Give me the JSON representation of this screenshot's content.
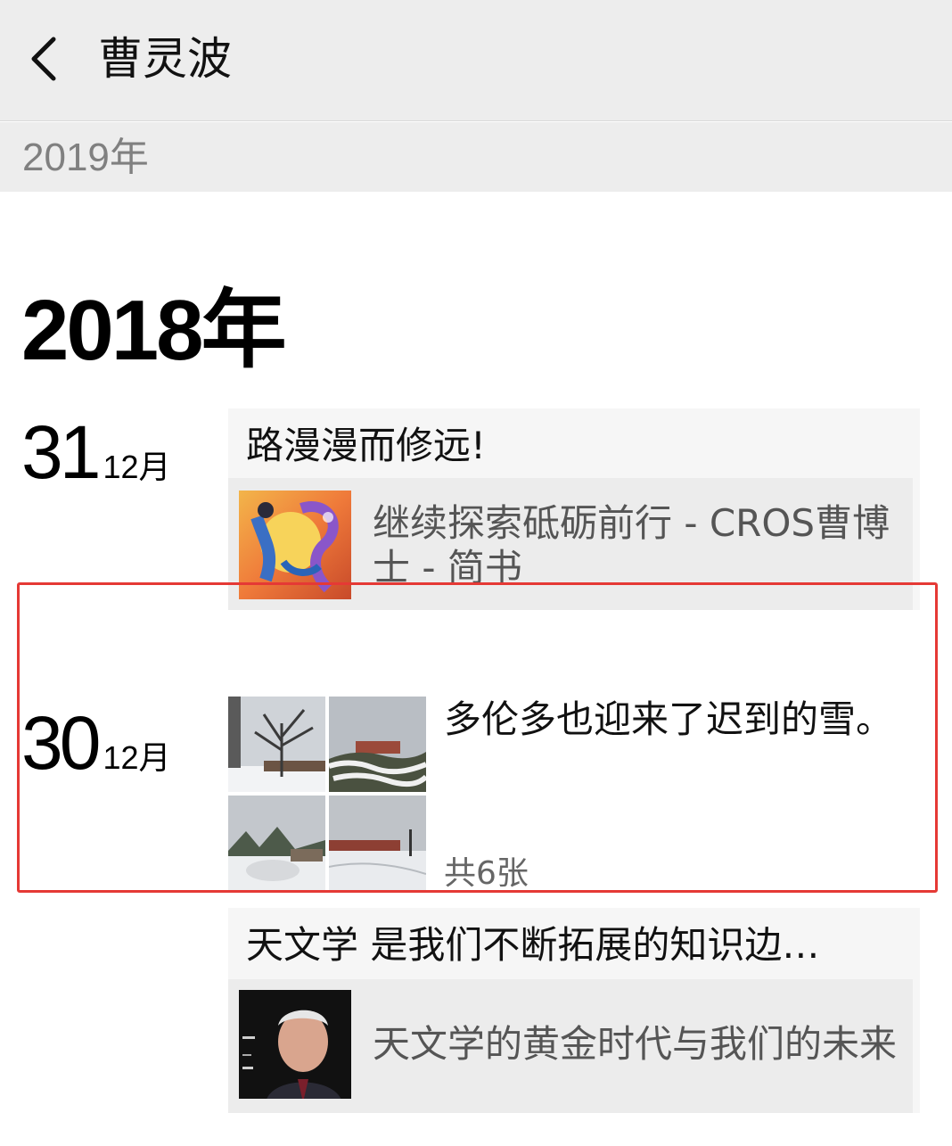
{
  "navbar": {
    "title": "曹灵波"
  },
  "year_bar": {
    "label": "2019年"
  },
  "section": {
    "year": "2018年"
  },
  "posts": [
    {
      "day": "31",
      "month": "12月",
      "title": "路漫漫而修远!",
      "link": {
        "text": "继续探索砥砺前行 - CROS曹博士 - 简书"
      }
    },
    {
      "day": "30",
      "month": "12月",
      "text": "多伦多也迎来了迟到的雪。",
      "photo_count": "共6张"
    },
    {
      "title": "天文学 是我们不断拓展的知识边…",
      "link": {
        "text": "天文学的黄金时代与我们的未来"
      }
    }
  ],
  "colors": {
    "highlight_border": "#e53935",
    "header_bg": "#ededed",
    "card_bg": "#f6f6f6"
  }
}
